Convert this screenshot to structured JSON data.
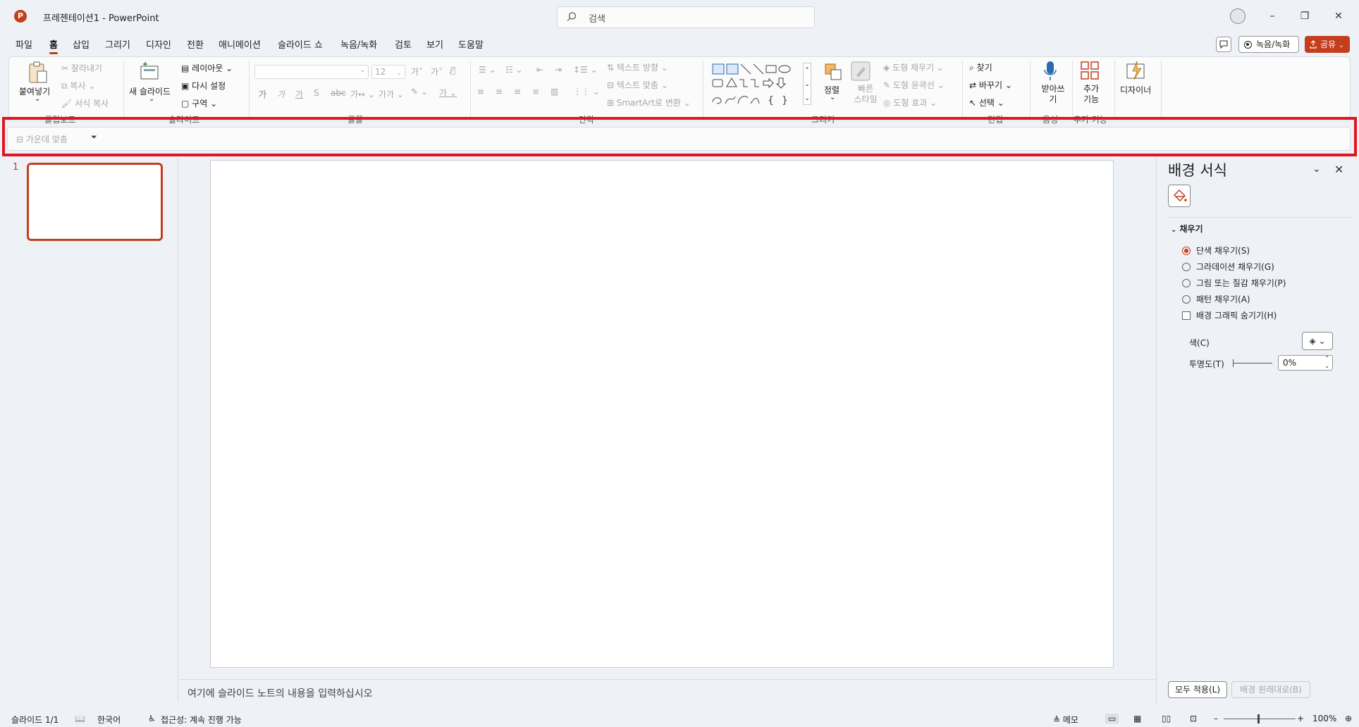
{
  "app": {
    "logo_letter": "P",
    "title": "프레젠테이션1  -  PowerPoint",
    "accent": "#c43e1c"
  },
  "search": {
    "placeholder": "검색"
  },
  "window": {
    "minimize": "–",
    "restore": "❐",
    "close": "✕"
  },
  "menu": {
    "tabs": [
      "파일",
      "홈",
      "삽입",
      "그리기",
      "디자인",
      "전환",
      "애니메이션",
      "슬라이드 쇼",
      "녹음/녹화",
      "검토",
      "보기",
      "도움말"
    ],
    "active_tab": "홈",
    "record_label": "녹음/녹화",
    "share_label": "공유"
  },
  "ribbon": {
    "clipboard": {
      "paste": "붙여넣기",
      "cut": "잘라내기",
      "copy": "복사",
      "format_painter": "서식 복사",
      "label": "클립보드"
    },
    "slides": {
      "new_slide": "새 슬라이드",
      "layout": "레이아웃",
      "reset": "다시 설정",
      "section": "구역",
      "label": "슬라이드"
    },
    "font": {
      "font_name": "",
      "font_size": "12",
      "label": "글꼴"
    },
    "paragraph": {
      "text_direction": "텍스트 방향",
      "align_text": "텍스트 맞춤",
      "smartart": "SmartArt로 변환",
      "label": "단락"
    },
    "drawing": {
      "arrange": "정렬",
      "quick_styles": "빠른 스타일",
      "shape_fill": "도형 채우기",
      "shape_outline": "도형 윤곽선",
      "shape_effects": "도형 효과",
      "label": "그리기"
    },
    "editing": {
      "find": "찾기",
      "replace": "바꾸기",
      "select": "선택",
      "label": "편집"
    },
    "voice": {
      "dictate": "받아쓰기",
      "label": "음성"
    },
    "addins": {
      "addins": "추가 기능",
      "label": "추가 기능"
    },
    "designer": {
      "designer": "디자이너"
    }
  },
  "qat": {
    "align_center": "가운데 맞춤"
  },
  "thumbnails": {
    "slide_number": "1"
  },
  "notes": {
    "placeholder": "여기에 슬라이드 노트의 내용을 입력하십시오"
  },
  "format_pane": {
    "title": "배경 서식",
    "section": "채우기",
    "options": [
      {
        "label": "단색 채우기(S)",
        "selected": true
      },
      {
        "label": "그라데이션 채우기(G)",
        "selected": false
      },
      {
        "label": "그림 또는 질감 채우기(P)",
        "selected": false
      },
      {
        "label": "패턴 채우기(A)",
        "selected": false
      }
    ],
    "hide_graphics": "배경 그래픽 숨기기(H)",
    "color_label": "색(C)",
    "transparency_label": "투명도(T)",
    "transparency_value": "0%",
    "apply_all": "모두 적용(L)",
    "reset_background": "배경 원래대로(B)"
  },
  "status": {
    "slide_count": "슬라이드 1/1",
    "language": "한국어",
    "accessibility": "접근성: 계속 진행 가능",
    "notes": "메모",
    "zoom": "100%"
  }
}
